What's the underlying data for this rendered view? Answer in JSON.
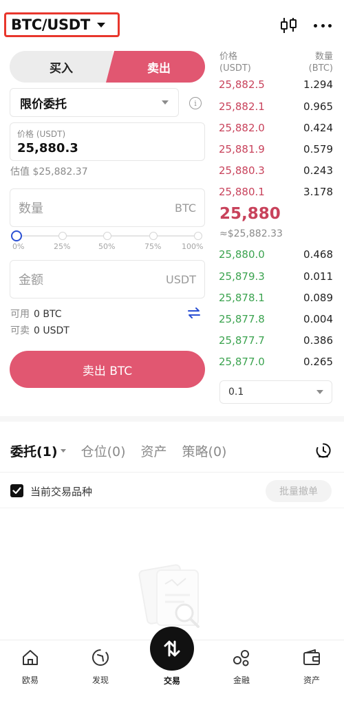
{
  "header": {
    "pair": "BTC/USDT",
    "chart_icon": "candlestick-icon",
    "more_icon": "more-dots-icon"
  },
  "form": {
    "buy_label": "买入",
    "sell_label": "卖出",
    "order_type": "限价委托",
    "price_label": "价格 (USDT)",
    "price_value": "25,880.3",
    "estimate": "估值 $25,882.37",
    "quantity_placeholder": "数量",
    "quantity_unit": "BTC",
    "slider_marks": [
      "0%",
      "25%",
      "50%",
      "75%",
      "100%"
    ],
    "slider_value": 0,
    "amount_placeholder": "金额",
    "amount_unit": "USDT",
    "available_label": "可用",
    "available_value": "0 BTC",
    "sellable_label": "可卖",
    "sellable_value": "0 USDT",
    "submit_label": "卖出 BTC"
  },
  "orderbook": {
    "price_header": "价格\n(USDT)",
    "qty_header": "数量\n(BTC)",
    "asks": [
      {
        "price": "25,882.5",
        "qty": "1.294"
      },
      {
        "price": "25,882.1",
        "qty": "0.965"
      },
      {
        "price": "25,882.0",
        "qty": "0.424"
      },
      {
        "price": "25,881.9",
        "qty": "0.579"
      },
      {
        "price": "25,880.3",
        "qty": "0.243"
      },
      {
        "price": "25,880.1",
        "qty": "3.178"
      }
    ],
    "last_price": "25,880",
    "last_price_usd": "≈$25,882.33",
    "bids": [
      {
        "price": "25,880.0",
        "qty": "0.468"
      },
      {
        "price": "25,879.3",
        "qty": "0.011"
      },
      {
        "price": "25,878.1",
        "qty": "0.089"
      },
      {
        "price": "25,877.8",
        "qty": "0.004"
      },
      {
        "price": "25,877.7",
        "qty": "0.386"
      },
      {
        "price": "25,877.0",
        "qty": "0.265"
      }
    ],
    "depth": "0.1",
    "colors": {
      "ask": "#c8425b",
      "bid": "#3ba34f"
    }
  },
  "orders_tabs": [
    "委托(1)",
    "仓位(0)",
    "资产",
    "策略(0)"
  ],
  "filter": {
    "label": "当前交易品种",
    "cancel_all": "批量撤单"
  },
  "tabbar": {
    "items": [
      {
        "label": "欧易",
        "icon": "home-icon"
      },
      {
        "label": "发现",
        "icon": "discover-icon"
      },
      {
        "label": "交易",
        "icon": "trade-swap-icon"
      },
      {
        "label": "金融",
        "icon": "finance-icon"
      },
      {
        "label": "资产",
        "icon": "wallet-icon"
      }
    ]
  },
  "accent": {
    "sell": "#e15771",
    "slider": "#2a4fd3"
  }
}
